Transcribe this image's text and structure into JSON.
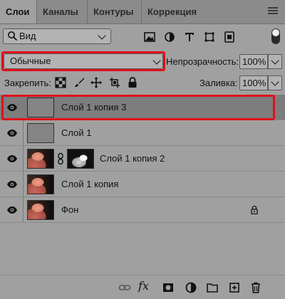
{
  "tabs": [
    {
      "label": "Слои",
      "active": true
    },
    {
      "label": "Каналы",
      "active": false
    },
    {
      "label": "Контуры",
      "active": false
    },
    {
      "label": "Коррекция",
      "active": false
    }
  ],
  "filter": {
    "search_icon": "search-icon",
    "value": "Вид",
    "icons": [
      "image-filter-icon",
      "adjustment-filter-icon",
      "type-filter-icon",
      "shape-filter-icon",
      "smart-object-filter-icon"
    ]
  },
  "blend": {
    "mode": "Обычные",
    "opacity_label": "Непрозрачность:",
    "opacity_value": "100%"
  },
  "lock": {
    "label": "Закрепить:",
    "icons": [
      "lock-transparent-pixels-icon",
      "lock-image-pixels-icon",
      "lock-position-icon",
      "lock-artboard-icon",
      "lock-all-icon"
    ],
    "fill_label": "Заливка:",
    "fill_value": "100%"
  },
  "layers": [
    {
      "name": "Слой 1 копия 3",
      "selected": true,
      "visible": true,
      "thumb": "gray",
      "mask": false,
      "locked": false
    },
    {
      "name": "Слой 1",
      "selected": false,
      "visible": true,
      "thumb": "gray",
      "mask": false,
      "locked": false
    },
    {
      "name": "Слой 1 копия 2",
      "selected": false,
      "visible": true,
      "thumb": "photo",
      "mask": true,
      "locked": false
    },
    {
      "name": "Слой 1 копия",
      "selected": false,
      "visible": true,
      "thumb": "photo",
      "mask": false,
      "locked": false
    },
    {
      "name": "Фон",
      "selected": false,
      "visible": true,
      "thumb": "photo",
      "mask": false,
      "locked": true
    }
  ],
  "bottom_bar": {
    "fx_label": "fx",
    "icons": [
      "link-layers-icon",
      "layer-style-icon",
      "add-mask-icon",
      "adjustment-layer-icon",
      "new-group-icon",
      "new-layer-icon",
      "delete-layer-icon"
    ]
  },
  "colors": {
    "panel": "#a0a0a0",
    "tabs_bg": "#8b8b8b",
    "highlight": "#e0101a",
    "selected_row": "#7d7d7d"
  }
}
